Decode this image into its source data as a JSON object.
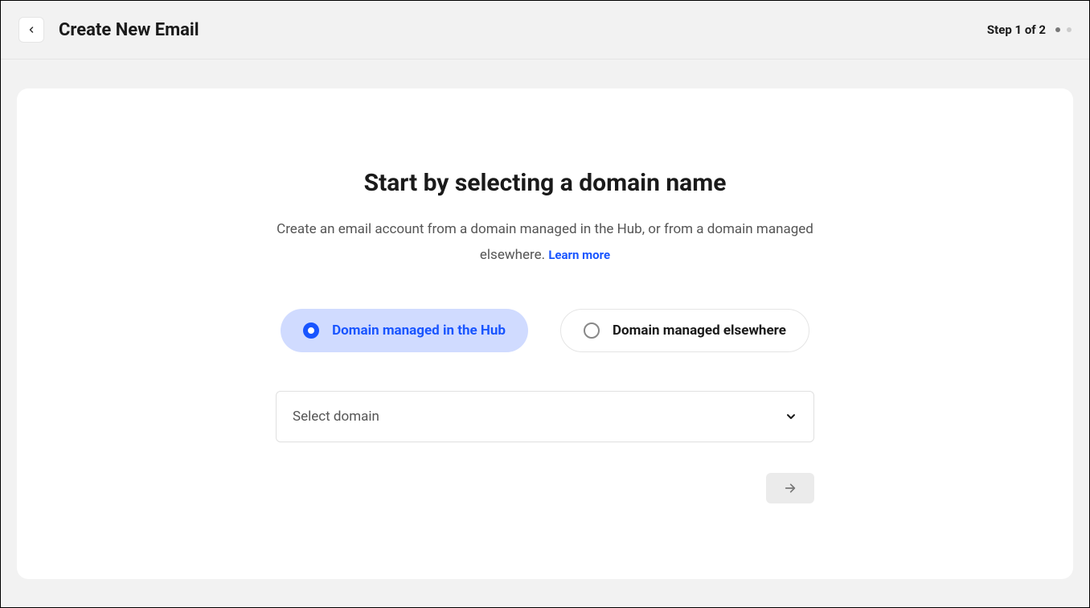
{
  "header": {
    "title": "Create New Email",
    "step_label": "Step 1 of 2"
  },
  "main": {
    "heading": "Start by selecting a domain name",
    "description_part1": "Create an email account from a domain managed in the Hub, or from a domain managed elsewhere. ",
    "learn_more_label": "Learn more",
    "options": {
      "hub_label": "Domain managed in the Hub",
      "elsewhere_label": "Domain managed elsewhere"
    },
    "select": {
      "placeholder": "Select domain"
    }
  }
}
